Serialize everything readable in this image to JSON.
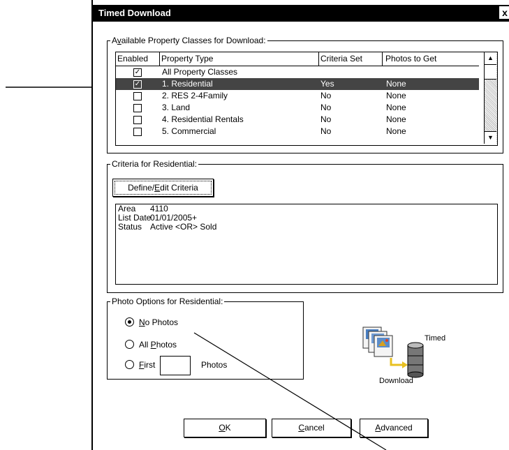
{
  "window": {
    "title": "Timed Download",
    "close_glyph": "x"
  },
  "property_group": {
    "legend_prefix": "A",
    "legend_hotkey": "v",
    "legend_rest": "ailable Property Classes for Download:",
    "columns": [
      "Enabled",
      "Property Type",
      "Criteria Set",
      "Photos to Get"
    ],
    "rows": [
      {
        "checked": "✓",
        "type": "All Property Classes",
        "criteria": "",
        "photos": ""
      },
      {
        "checked": "✓",
        "type": "1. Residential",
        "criteria": "Yes",
        "photos": "None"
      },
      {
        "checked": "",
        "type": "2. RES 2-4Family",
        "criteria": "No",
        "photos": "None"
      },
      {
        "checked": "",
        "type": "3. Land",
        "criteria": "No",
        "photos": "None"
      },
      {
        "checked": "",
        "type": "4. Residential Rentals",
        "criteria": "No",
        "photos": "None"
      },
      {
        "checked": "",
        "type": "5. Commercial",
        "criteria": "No",
        "photos": "None"
      }
    ],
    "selected_index": 1,
    "scroll_up_glyph": "▲",
    "scroll_down_glyph": "▼"
  },
  "criteria_group": {
    "legend": "Criteria for Residential:",
    "button_prefix": "Define/",
    "button_hotkey": "E",
    "button_rest": "dit Criteria",
    "lines": [
      {
        "label": "Area",
        "value": "4110"
      },
      {
        "label": "List Date",
        "value": "01/01/2005+"
      },
      {
        "label": "Status",
        "value": "Active <OR> Sold"
      }
    ]
  },
  "photo_group": {
    "legend": "Photo Options for Residential:",
    "no_photos_hotkey": "N",
    "no_photos_rest": "o Photos",
    "all_photos_prefix": "All ",
    "all_photos_hotkey": "P",
    "all_photos_rest": "hotos",
    "first_hotkey": "F",
    "first_rest": "irst",
    "first_value": "",
    "photos_suffix": "Photos",
    "selected": "no_photos"
  },
  "illustration": {
    "timed_label": "Timed",
    "download_label": "Download"
  },
  "buttons": {
    "ok_hotkey": "O",
    "ok_rest": "K",
    "cancel_hotkey": "C",
    "cancel_rest": "ancel",
    "advanced_hotkey": "A",
    "advanced_rest": "dvanced"
  },
  "colors": {
    "titlebar": "#000000",
    "selected_row": "#444444",
    "background": "#ffffff"
  }
}
